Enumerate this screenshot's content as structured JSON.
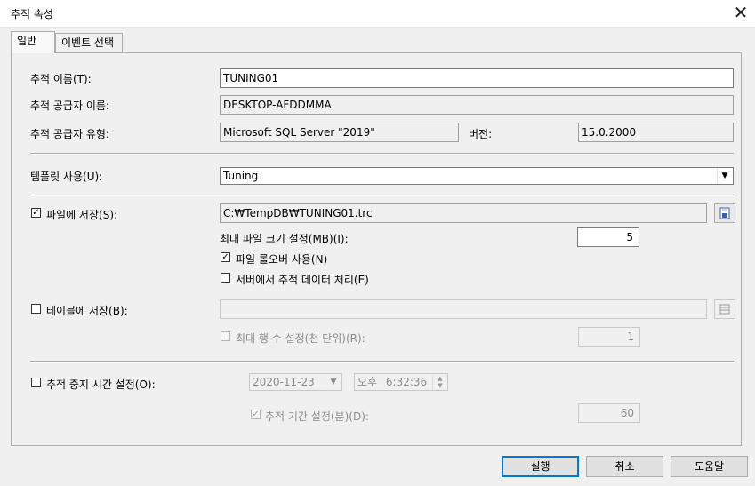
{
  "window": {
    "title": "추적 속성"
  },
  "tabs": [
    {
      "label": "일반",
      "active": true
    },
    {
      "label": "이벤트 선택",
      "active": false
    }
  ],
  "general": {
    "trace_name_label": "추적 이름(T):",
    "trace_name_value": "TUNING01",
    "provider_name_label": "추적 공급자 이름:",
    "provider_name_value": "DESKTOP-AFDDMMA",
    "provider_type_label": "추적 공급자 유형:",
    "provider_type_value": "Microsoft SQL Server \"2019\"",
    "version_label": "버전:",
    "version_value": "15.0.2000",
    "template_label": "템플릿 사용(U):",
    "template_value": "Tuning"
  },
  "save_file": {
    "label": "파일에 저장(S):",
    "checked": true,
    "path": "C:₩TempDB₩TUNING01.trc",
    "max_size_label": "최대 파일 크기 설정(MB)(I):",
    "max_size_value": "5",
    "rollover_label": "파일 롤오버 사용(N)",
    "rollover_checked": true,
    "server_process_label": "서버에서 추적 데이터 처리(E)",
    "server_process_checked": false
  },
  "save_table": {
    "label": "테이블에 저장(B):",
    "checked": false,
    "path": "",
    "max_rows_label": "최대 행 수 설정(천 단위)(R):",
    "max_rows_checked": false,
    "max_rows_value": "1"
  },
  "stop_time": {
    "label": "추적 중지 시간 설정(O):",
    "checked": false,
    "date": "2020-11-23",
    "time_ampm": "오후",
    "time": "6:32:36",
    "duration_label": "추적 기간 설정(분)(D):",
    "duration_checked": true,
    "duration_value": "60"
  },
  "buttons": {
    "run": "실행",
    "cancel": "취소",
    "help": "도움말"
  },
  "icons": {
    "close": "close-icon",
    "browse_file": "save-file-icon",
    "browse_table": "table-icon",
    "dropdown": "chevron-down-icon"
  }
}
